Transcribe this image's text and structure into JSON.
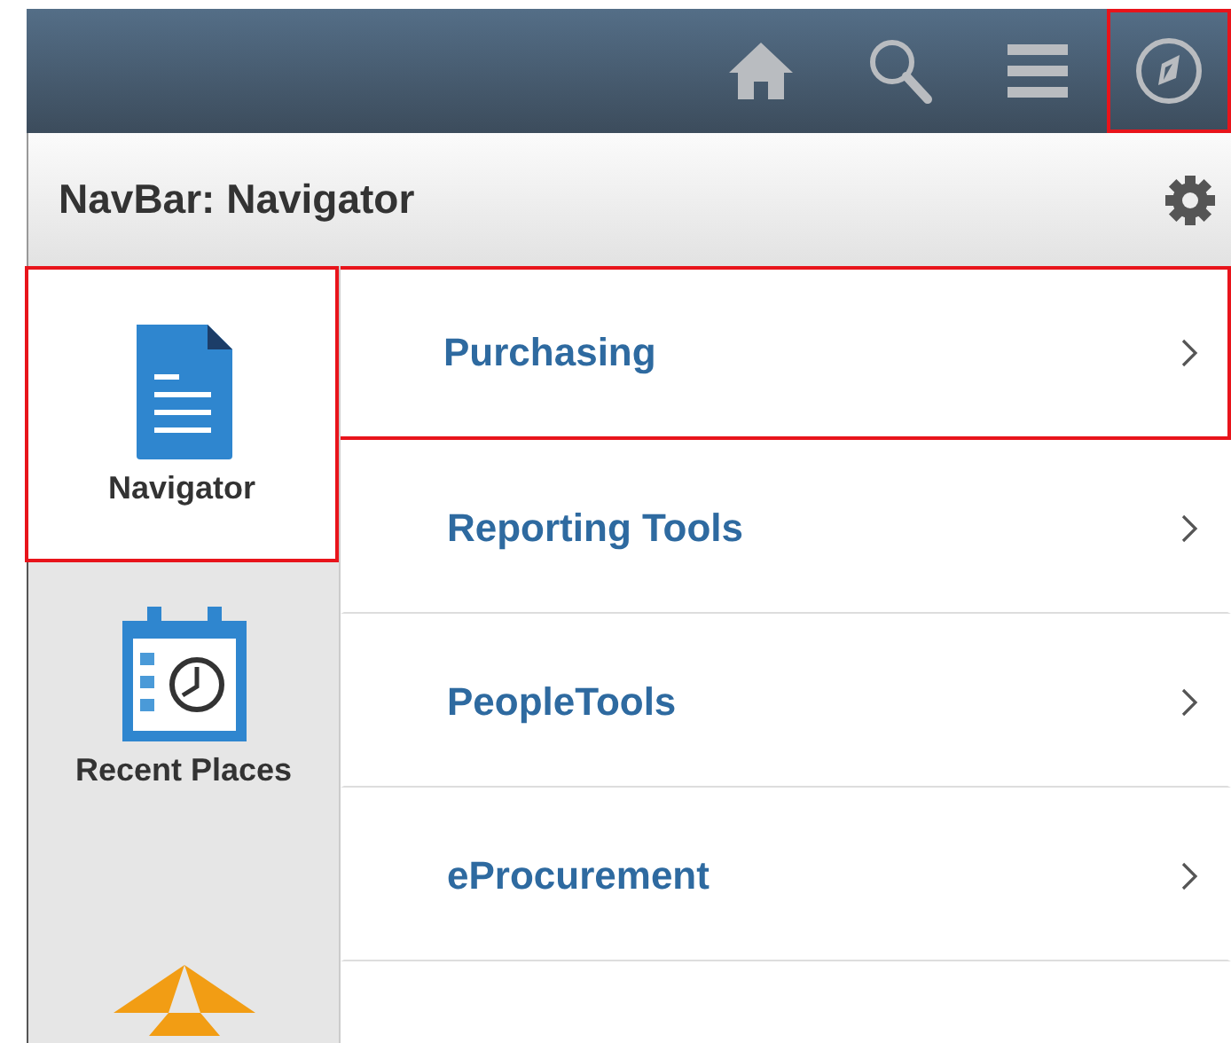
{
  "toolbar": {
    "buttons": [
      {
        "kind": "home",
        "highlighted": false
      },
      {
        "kind": "search",
        "highlighted": false
      },
      {
        "kind": "menu",
        "highlighted": false
      },
      {
        "kind": "navigator",
        "highlighted": true
      }
    ]
  },
  "header": {
    "title": "NavBar: Navigator"
  },
  "tabs": [
    {
      "kind": "document",
      "label": "Navigator",
      "selected": true,
      "highlighted": true
    },
    {
      "kind": "recent",
      "label": "Recent Places",
      "selected": false,
      "highlighted": false
    },
    {
      "kind": "favorites",
      "selected": false,
      "highlighted": false
    }
  ],
  "items": [
    {
      "label": "Purchasing",
      "highlighted": true
    },
    {
      "label": "Reporting Tools",
      "highlighted": false
    },
    {
      "label": "PeopleTools",
      "highlighted": false
    },
    {
      "label": "eProcurement",
      "highlighted": false
    }
  ]
}
